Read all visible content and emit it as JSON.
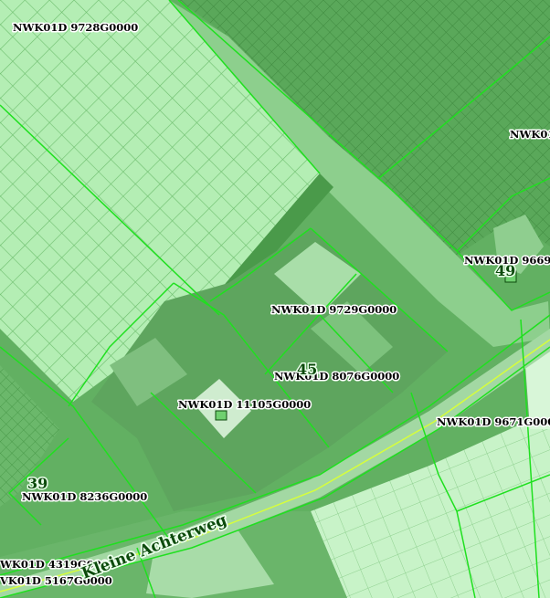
{
  "parcels": [
    {
      "label": "NWK01D  9728G0000"
    },
    {
      "label": "NWK01"
    },
    {
      "label": "NWK01D  9669G"
    },
    {
      "label": "NWK01D  9729G0000"
    },
    {
      "label": "NWK01D  8076G0000"
    },
    {
      "label": "NWK01D  11105G0000"
    },
    {
      "label": "NWK01D  9671G0000"
    },
    {
      "label": "NWK01D  8236G0000"
    },
    {
      "label": "WK01D  4319G0000"
    },
    {
      "label": "VK01D  5167G0000"
    }
  ],
  "house_numbers": [
    {
      "number": "49"
    },
    {
      "number": "45"
    },
    {
      "number": "39"
    }
  ],
  "street": {
    "name": "Kleine Achterweg"
  },
  "colors": {
    "boundary": "#1fe01f",
    "greenhouse": "#b5f0b5",
    "overlay_tint": "#5fae5f",
    "label_text": "#000000",
    "label_halo": "#ffffff"
  }
}
